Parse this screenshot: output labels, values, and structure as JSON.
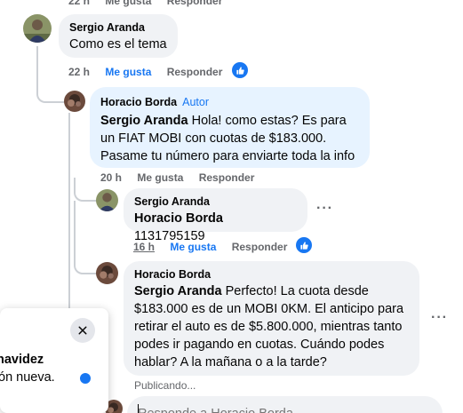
{
  "top_actions": {
    "time": "22 h",
    "like": "Me gusta",
    "reply": "Responder"
  },
  "comments": [
    {
      "author": "Sergio Aranda",
      "text": "Como es el tema",
      "time": "22 h",
      "like": "Me gusta",
      "reply": "Responder",
      "liked": true
    },
    {
      "author": "Horacio Borda",
      "badge": "Autor",
      "mention": "Sergio Aranda",
      "text": " Hola! como estas? Es para un FIAT MOBI con cuotas de $183.000. Pasame tu número para enviarte toda la info",
      "time": "20 h",
      "like": "Me gusta",
      "reply": "Responder"
    },
    {
      "author": "Sergio Aranda",
      "mention": "Horacio Borda",
      "text": " 1131795159",
      "time": "16 h",
      "like": "Me gusta",
      "reply": "Responder",
      "liked": true
    },
    {
      "author": "Horacio Borda",
      "mention": "Sergio Aranda",
      "text": " Perfecto! La cuota desde $183.000 es de un MOBI 0KM. El anticipo para retirar el auto es de $5.800.000, mientras tanto podes ir pagando en cuotas. Cuándo podes hablar? A la mañana o a la tarde?",
      "status": "Publicando..."
    }
  ],
  "reply_input": {
    "placeholder": "Responde a Horacio Borda"
  },
  "popup": {
    "name": "navidez",
    "subtitle": "ón nueva."
  },
  "colors": {
    "accent": "#1877f2",
    "bubble_gray": "#f0f2f5",
    "bubble_author": "#e7f3ff",
    "muted": "#65676b"
  },
  "icons": {
    "like_badge": "thumbs-up-icon",
    "more": "more-horizontal-icon",
    "close": "close-icon"
  }
}
